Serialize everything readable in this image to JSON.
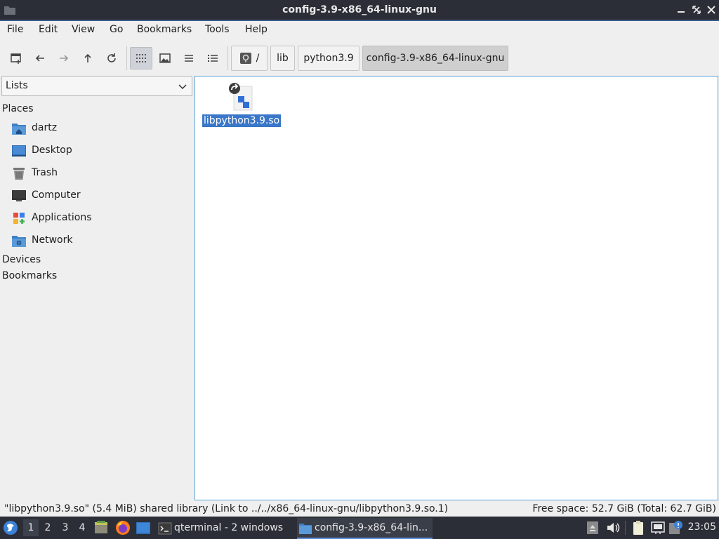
{
  "window": {
    "title": "config-3.9-x86_64-linux-gnu"
  },
  "menu": [
    "File",
    "Edit",
    "View",
    "Go",
    "Bookmarks",
    "Tools",
    "Help"
  ],
  "toolbar": {
    "buttons": [
      "new-tab-icon",
      "back-icon",
      "forward-icon",
      "up-icon",
      "reload-icon",
      "icon-view-icon",
      "thumbnail-view-icon",
      "compact-view-icon",
      "detailed-list-view-icon"
    ],
    "active_view": "icon-view"
  },
  "breadcrumb": {
    "root_label": "/",
    "items": [
      "lib",
      "python3.9",
      "config-3.9-x86_64-linux-gnu"
    ]
  },
  "sidebar": {
    "selector_value": "Lists",
    "places_heading": "Places",
    "places": [
      {
        "label": "dartz",
        "icon": "home-folder-icon"
      },
      {
        "label": "Desktop",
        "icon": "desktop-icon"
      },
      {
        "label": "Trash",
        "icon": "trash-icon"
      },
      {
        "label": "Computer",
        "icon": "computer-icon"
      },
      {
        "label": "Applications",
        "icon": "applications-icon"
      },
      {
        "label": "Network",
        "icon": "network-folder-icon"
      }
    ],
    "devices_heading": "Devices",
    "bookmarks_heading": "Bookmarks"
  },
  "files": [
    {
      "name": "libpython3.9.so",
      "selected": true,
      "icon": "symlink-library-icon"
    }
  ],
  "status": {
    "left": "\"libpython3.9.so\" (5.4 MiB) shared library (Link to ../../x86_64-linux-gnu/libpython3.9.so.1)",
    "right": "Free space: 52.7 GiB (Total: 62.7 GiB)"
  },
  "taskbar": {
    "desktops": [
      "1",
      "2",
      "3",
      "4"
    ],
    "active_desktop": "1",
    "tasks": [
      {
        "label": "qterminal - 2 windows",
        "icon": "terminal-icon",
        "active": false
      },
      {
        "label": "config-3.9-x86_64-lin...",
        "icon": "folder-icon",
        "active": true
      }
    ],
    "clock": "23:05"
  },
  "colors": {
    "selection": "#3a77c8",
    "titlebar": "#2b2e37",
    "focus_border": "#5aa3d6"
  }
}
